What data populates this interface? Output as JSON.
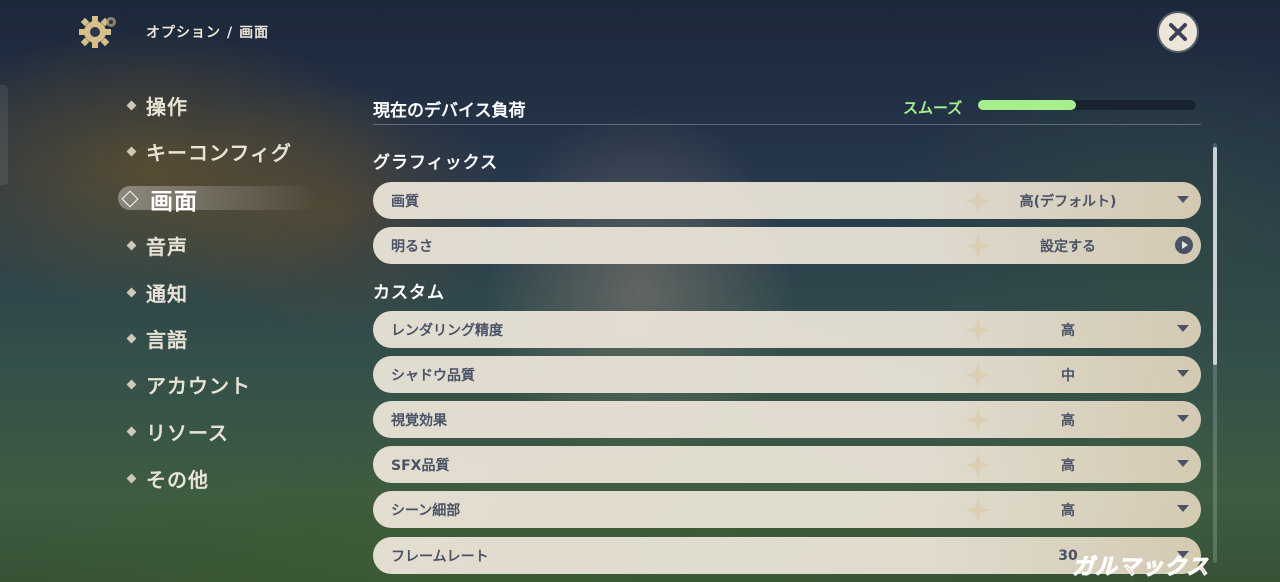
{
  "header": {
    "breadcrumb": [
      "オプション",
      "画面"
    ],
    "breadcrumb_sep": "/",
    "settings_icon": "gear-icon",
    "close_icon": "close-icon"
  },
  "sidebar": {
    "items": [
      {
        "label": "操作",
        "active": false
      },
      {
        "label": "キーコンフィグ",
        "active": false
      },
      {
        "label": "画面",
        "active": true
      },
      {
        "label": "音声",
        "active": false
      },
      {
        "label": "通知",
        "active": false
      },
      {
        "label": "言語",
        "active": false
      },
      {
        "label": "アカウント",
        "active": false
      },
      {
        "label": "リソース",
        "active": false
      },
      {
        "label": "その他",
        "active": false
      }
    ]
  },
  "device_load": {
    "title": "現在のデバイス負荷",
    "status": "スムーズ",
    "level": 0.45,
    "status_color": "#a6ef8c"
  },
  "graphics": {
    "title": "グラフィックス",
    "rows": [
      {
        "label": "画質",
        "value": "高(デフォルト)",
        "control": "dropdown"
      },
      {
        "label": "明るさ",
        "value": "設定する",
        "control": "go"
      }
    ]
  },
  "custom": {
    "title": "カスタム",
    "rows": [
      {
        "label": "レンダリング精度",
        "value": "高",
        "control": "dropdown"
      },
      {
        "label": "シャドウ品質",
        "value": "中",
        "control": "dropdown"
      },
      {
        "label": "視覚効果",
        "value": "高",
        "control": "dropdown"
      },
      {
        "label": "SFX品質",
        "value": "高",
        "control": "dropdown"
      },
      {
        "label": "シーン細部",
        "value": "高",
        "control": "dropdown"
      },
      {
        "label": "フレームレート",
        "value": "30",
        "control": "dropdown"
      }
    ]
  },
  "watermark": "ガルマックス",
  "colors": {
    "row_bg": "#ece5d8",
    "row_text": "#4a5366",
    "accent_green": "#a6ef8c"
  }
}
